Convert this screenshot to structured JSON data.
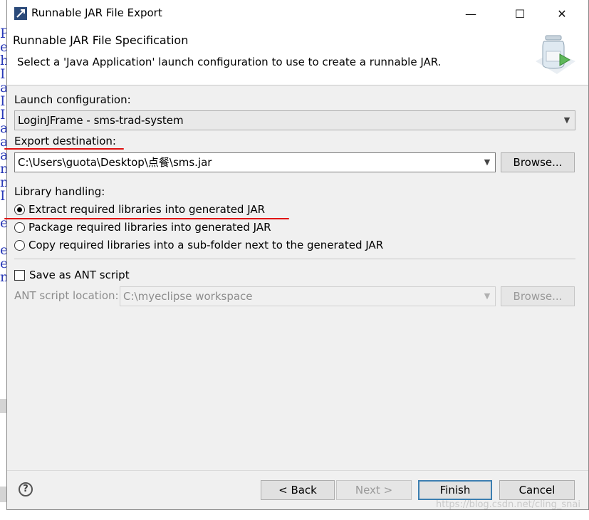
{
  "window": {
    "title": "Runnable JAR File Export",
    "minimize_glyph": "—",
    "maximize_glyph": "☐",
    "close_glyph": "✕"
  },
  "banner": {
    "title": "Runnable JAR File Specification",
    "description": "Select a 'Java Application' launch configuration to use to create a runnable JAR."
  },
  "launch": {
    "label": "Launch configuration:",
    "value": "LoginJFrame - sms-trad-system"
  },
  "export": {
    "label": "Export destination:",
    "value": "C:\\Users\\guota\\Desktop\\点餐\\sms.jar",
    "browse_label": "Browse..."
  },
  "library": {
    "label": "Library handling:",
    "options": [
      {
        "label": "Extract required libraries into generated JAR",
        "checked": true
      },
      {
        "label": "Package required libraries into generated JAR",
        "checked": false
      },
      {
        "label": "Copy required libraries into a sub-folder next to the generated JAR",
        "checked": false
      }
    ]
  },
  "ant": {
    "checkbox_label": "Save as ANT script",
    "checked": false,
    "location_label": "ANT script location:",
    "location_value": "C:\\myeclipse workspace",
    "browse_label": "Browse..."
  },
  "footer": {
    "help_glyph": "?",
    "back_label": "< Back",
    "next_label": "Next >",
    "finish_label": "Finish",
    "cancel_label": "Cancel"
  },
  "watermark": "https://blog.csdn.net/cling_snai",
  "colors": {
    "dialog_bg": "#f0f0f0",
    "annotation_red": "#e01010",
    "default_button_border": "#3c7fb1"
  }
}
